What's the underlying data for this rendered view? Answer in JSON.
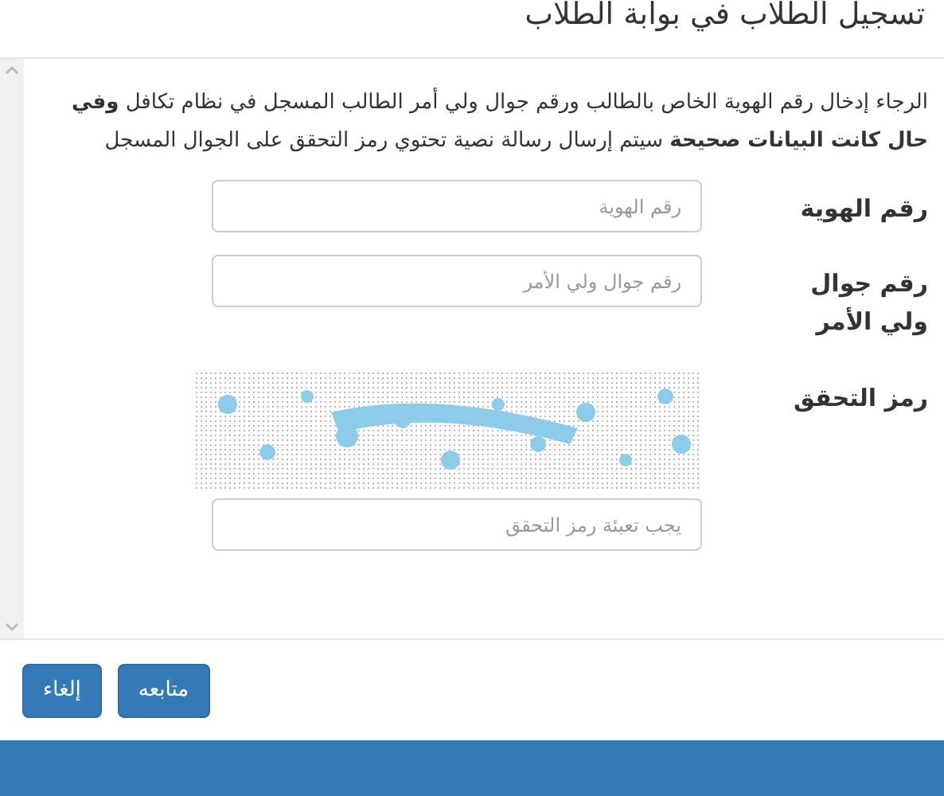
{
  "dialog": {
    "title": "تسجيل الطلاب في بوابة الطلاب"
  },
  "intro": "الرجاء إدخال رقم الهوية الخاص بالطالب ورقم جوال ولي أمر الطالب المسجل في نظام تكافل **وفي حال كانت البيانات صحيحة** سيتم إرسال رسالة نصية تحتوي رمز التحقق على الجوال المسجل",
  "fields": [
    {
      "label": "رقم الهوية",
      "placeholder": "رقم الهوية"
    },
    {
      "label": "رقم جوال ولي الأمر",
      "placeholder": "رقم جوال ولي الأمر"
    }
  ],
  "captcha": {
    "label": "رمز التحقق",
    "placeholder": "يجب تعبئة رمز التحقق"
  },
  "buttons": [
    "متابعه",
    "إلغاء"
  ]
}
